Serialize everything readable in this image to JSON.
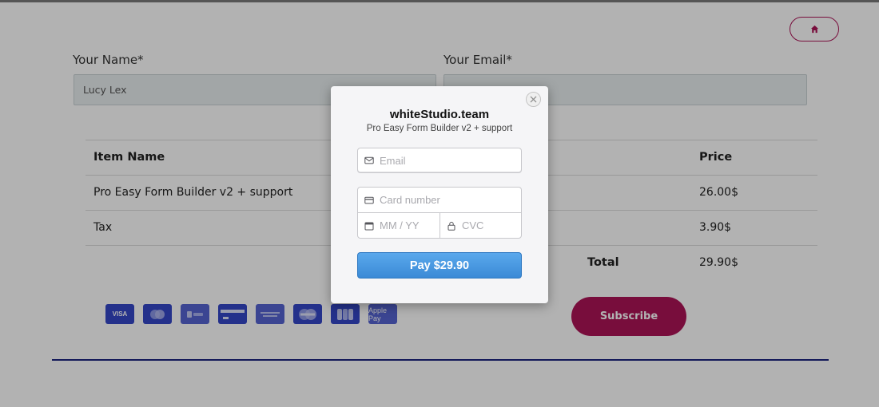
{
  "header": {
    "home_icon": "home-icon"
  },
  "form": {
    "name_label": "Your Name*",
    "name_value": "Lucy Lex",
    "email_label": "Your Email*",
    "email_value": ""
  },
  "table": {
    "headers": [
      "Item Name",
      "Price"
    ],
    "rows": [
      {
        "name": "Pro Easy Form Builder v2 + support",
        "price": "26.00$"
      },
      {
        "name": "Tax",
        "price": "3.90$"
      }
    ],
    "total_label": "Total",
    "total_value": "29.90$"
  },
  "payment_icons": [
    "VISA",
    "mastercard",
    "alipay",
    "card",
    "american express",
    "maestro",
    "JCB",
    "Apple Pay"
  ],
  "subscribe_label": "Subscribe",
  "modal": {
    "title": "whiteStudio.team",
    "subtitle": "Pro Easy Form Builder v2 + support",
    "email_placeholder": "Email",
    "card_placeholder": "Card number",
    "expiry_placeholder": "MM / YY",
    "cvc_placeholder": "CVC",
    "pay_label": "Pay $29.90"
  },
  "colors": {
    "accent": "#ad1457",
    "card_brand": "#3447c8",
    "pay_button": "#3b8ad6",
    "divider": "#1a237e"
  }
}
